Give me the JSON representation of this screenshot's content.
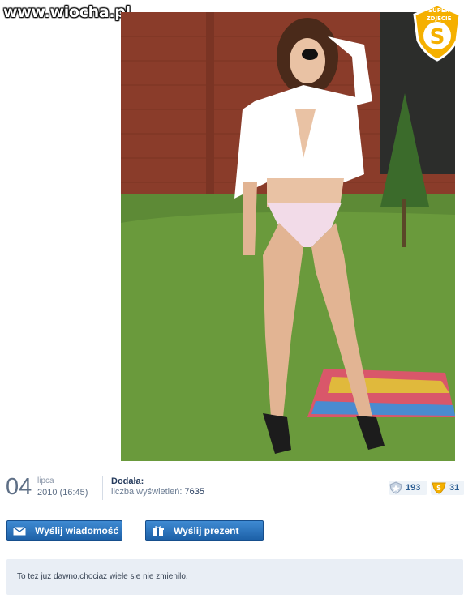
{
  "site": {
    "watermark": "www.wiocha.pl"
  },
  "badge": {
    "line1": "SUPER",
    "line2": "ZDJĘCIE",
    "letter": "S",
    "icon": "super-photo-badge-icon",
    "color": "#f5b000"
  },
  "photo": {
    "alt_icon": "photo-image"
  },
  "post": {
    "day": "04",
    "month": "lipca",
    "datetime": "2010 (16:45)",
    "added_by_label": "Dodała:",
    "views_label": "liczba wyświetleń:",
    "views": "7635"
  },
  "stats": {
    "shield_count": "193",
    "super_count": "31",
    "shield_icon": "shield-rating-icon",
    "super_icon": "super-badge-icon"
  },
  "actions": {
    "send_message": "Wyślij wiadomość",
    "send_gift": "Wyślij prezent",
    "message_icon": "envelope-icon",
    "gift_icon": "gift-icon"
  },
  "comment": {
    "text": "To tez juz dawno,chociaz wiele sie nie zmienilo."
  },
  "colors": {
    "accent": "#1c5fa6",
    "text_dark": "#243a5c",
    "comment_bg": "#e9eef5"
  }
}
